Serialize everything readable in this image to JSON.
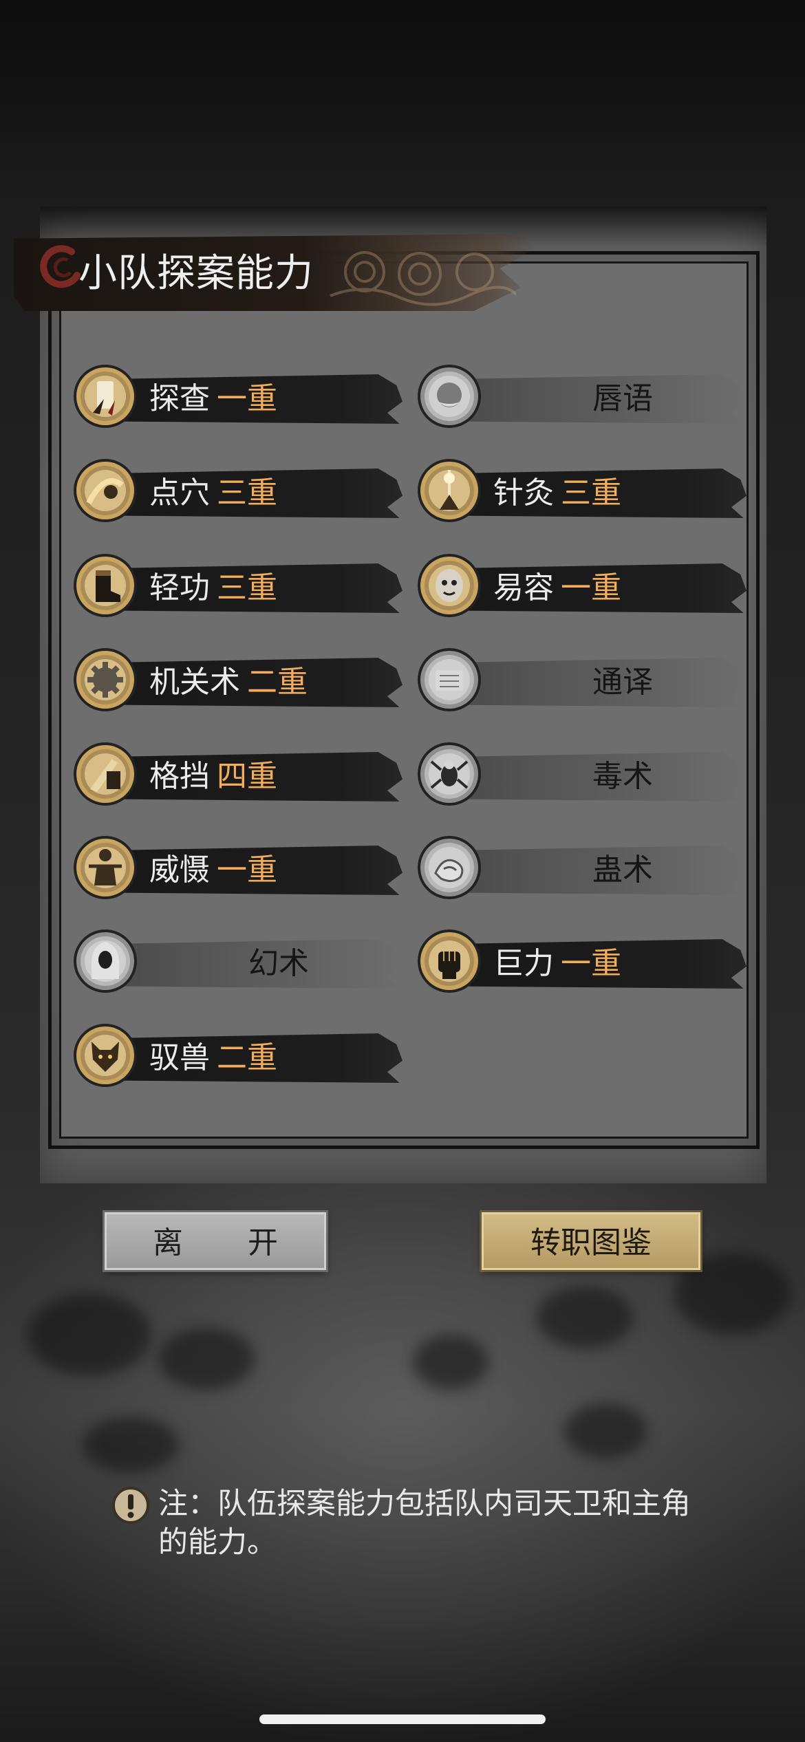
{
  "title": "小队探案能力",
  "skills": [
    {
      "name": "探查",
      "level": "一重",
      "active": true,
      "icon": "scroll-claw-icon"
    },
    {
      "name": "唇语",
      "level": "",
      "active": false,
      "icon": "lips-icon"
    },
    {
      "name": "点穴",
      "level": "三重",
      "active": true,
      "icon": "pressure-strike-icon"
    },
    {
      "name": "针灸",
      "level": "三重",
      "active": true,
      "icon": "acupuncture-needle-icon"
    },
    {
      "name": "轻功",
      "level": "三重",
      "active": true,
      "icon": "boot-icon"
    },
    {
      "name": "易容",
      "level": "一重",
      "active": true,
      "icon": "mask-icon"
    },
    {
      "name": "机关术",
      "level": "二重",
      "active": true,
      "icon": "gear-icon"
    },
    {
      "name": "通译",
      "level": "",
      "active": false,
      "icon": "book-scroll-icon"
    },
    {
      "name": "格挡",
      "level": "四重",
      "active": true,
      "icon": "block-blade-icon"
    },
    {
      "name": "毒术",
      "level": "",
      "active": false,
      "icon": "poison-spider-icon"
    },
    {
      "name": "威慑",
      "level": "一重",
      "active": true,
      "icon": "intimidate-figure-icon"
    },
    {
      "name": "蛊术",
      "level": "",
      "active": false,
      "icon": "gu-worm-icon"
    },
    {
      "name": "幻术",
      "level": "",
      "active": false,
      "icon": "hooded-figure-icon"
    },
    {
      "name": "巨力",
      "level": "一重",
      "active": true,
      "icon": "fist-icon"
    },
    {
      "name": "驭兽",
      "level": "二重",
      "active": true,
      "icon": "wolf-icon"
    }
  ],
  "buttons": {
    "leave": "离 开",
    "atlas": "转职图鉴"
  },
  "note": "注：队伍探案能力包括队内司天卫和主角的能力。",
  "colors": {
    "level_text": "#f2ac5c",
    "active_bar": "#1a1a1a",
    "atlas_button": "#c9b07a",
    "leave_button": "#aaaaaa"
  }
}
